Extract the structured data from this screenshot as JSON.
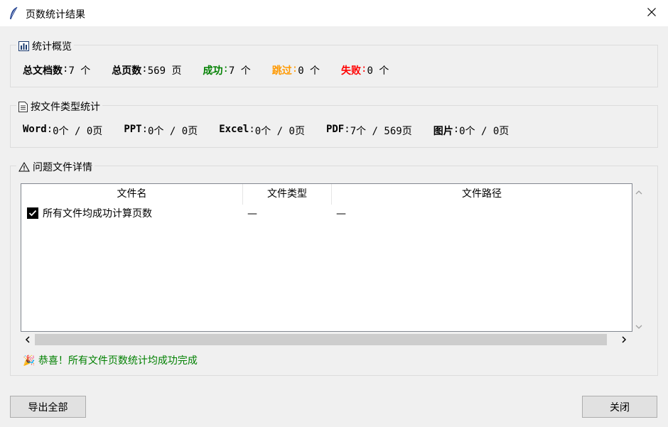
{
  "window": {
    "title": "页数统计结果",
    "app_icon": "quill-feather-icon",
    "close_icon": "close-icon"
  },
  "summary": {
    "legend": "统计概览",
    "legend_icon": "bar-chart-icon",
    "total_docs_label": "总文档数",
    "total_docs_value": "7 个",
    "total_pages_label": "总页数",
    "total_pages_value": "569 页",
    "success_label": "成功",
    "success_value": "7 个",
    "skipped_label": "跳过",
    "skipped_value": "0 个",
    "failed_label": "失败",
    "failed_value": "0 个",
    "sep": ": ",
    "colors": {
      "success": "#008000",
      "skipped": "#ff9900",
      "failed": "#ff0000"
    }
  },
  "by_type": {
    "legend": "按文件类型统计",
    "legend_icon": "document-icon",
    "word_label": "Word",
    "word_value": "0个 / 0页",
    "ppt_label": "PPT",
    "ppt_value": "0个 / 0页",
    "excel_label": "Excel",
    "excel_value": "0个 / 0页",
    "pdf_label": "PDF",
    "pdf_value": "7个 / 569页",
    "image_label": "图片",
    "image_value": "0个 / 0页",
    "sep": ": "
  },
  "issues": {
    "legend": "问题文件详情",
    "legend_icon": "warning-icon",
    "columns": [
      "文件名",
      "文件类型",
      "文件路径"
    ],
    "rows": [
      {
        "icon": "checkbox-checked-icon",
        "name": "所有文件均成功计算页数",
        "type": "—",
        "path": "—"
      }
    ],
    "message": "🎉 恭喜！所有文件页数统计均成功完成"
  },
  "buttons": {
    "export_all": "导出全部",
    "close": "关闭"
  }
}
